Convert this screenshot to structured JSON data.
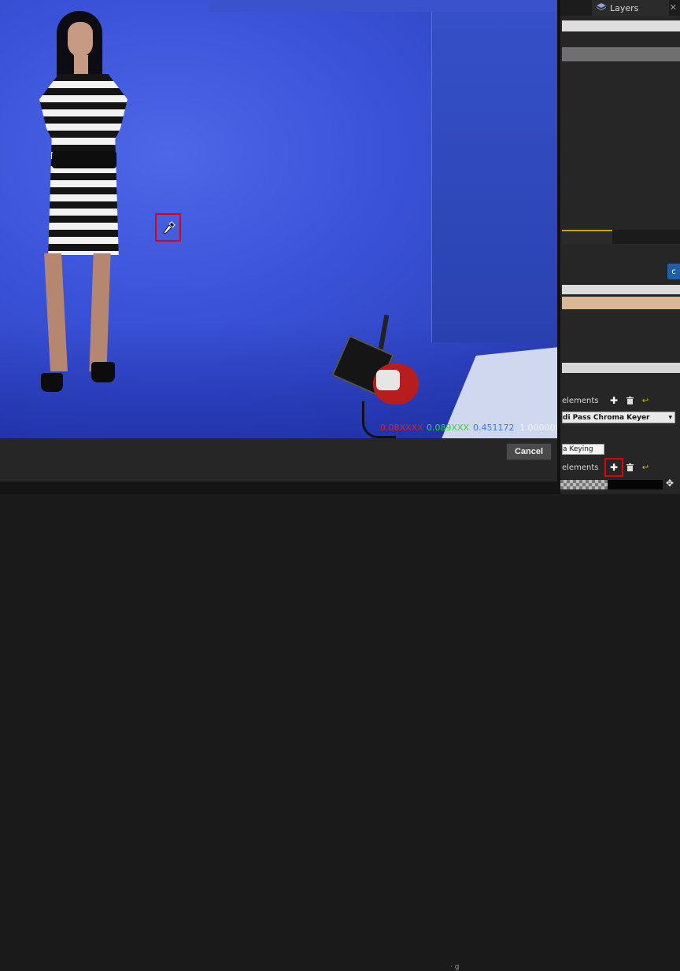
{
  "layers_panel": {
    "title": "Layers",
    "elements_label_1": "elements",
    "keyer_select_value": "di Pass Chroma Keyer",
    "keying_label": "a Keying",
    "elements_label_2": "elements",
    "blue_button_label": "c"
  },
  "picker_dialog": {
    "color_values": {
      "r": "0.08XXXX",
      "g": "0.089XXX",
      "b": "0.451172",
      "a": "1.000000"
    },
    "cancel_label": "Cancel"
  },
  "icons": {
    "layers": "layers-icon",
    "eyedropper": "eyedropper-icon",
    "add": "plus-icon",
    "delete": "trash-icon",
    "undo": "undo-icon",
    "move": "move-icon"
  },
  "colors": {
    "highlight": "#e00000",
    "accent_blue": "#1f5fa8",
    "tab_accent": "#d4a100"
  }
}
